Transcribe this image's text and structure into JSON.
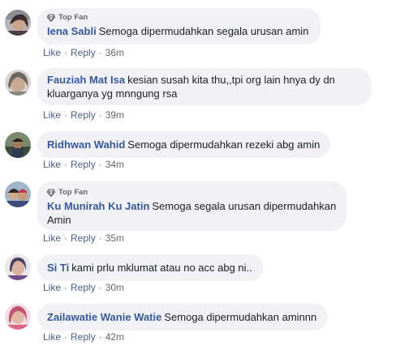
{
  "colors": {
    "bubble": "#f0f2f5",
    "author": "#385898",
    "meta": "#65676b"
  },
  "comments": [
    {
      "badge": "Top Fan",
      "author": "Iena Sabli",
      "text": "Semoga dipermudahkan segala urusan amin",
      "like": "Like",
      "reply": "Reply",
      "time": "36m"
    },
    {
      "badge": "",
      "author": "Fauziah Mat Isa",
      "text": "kesian susah kita thu,,tpi org lain hnya dy dn kluarganya yg mnngung rsa",
      "like": "Like",
      "reply": "Reply",
      "time": "39m"
    },
    {
      "badge": "",
      "author": "Ridhwan Wahid",
      "text": "Semoga dipermudahkan rezeki abg amin",
      "like": "Like",
      "reply": "Reply",
      "time": "34m"
    },
    {
      "badge": "Top Fan",
      "author": "Ku Munirah Ku Jatin",
      "text": "Semoga segala urusan dipermudahkan Amin",
      "like": "Like",
      "reply": "Reply",
      "time": "35m"
    },
    {
      "badge": "",
      "author": "Si Ti",
      "text": "kami prlu mklumat atau no acc abg ni..",
      "like": "Like",
      "reply": "Reply",
      "time": "30m"
    },
    {
      "badge": "",
      "author": "Zailawatie Wanie Watie",
      "text": "Semoga dipermudahkan aminnn",
      "like": "Like",
      "reply": "Reply",
      "time": "42m"
    }
  ]
}
